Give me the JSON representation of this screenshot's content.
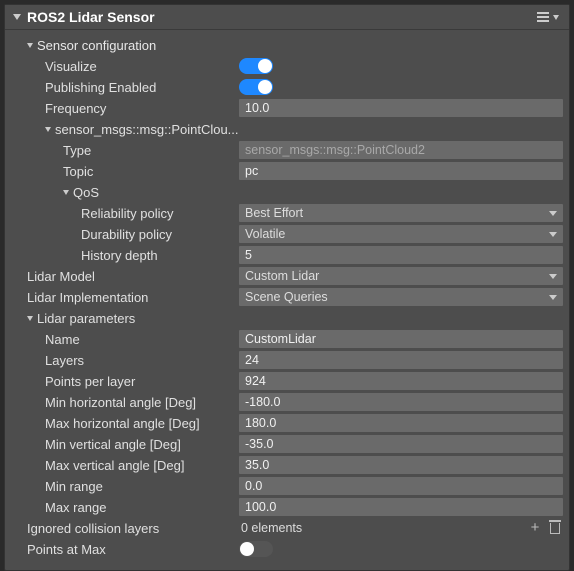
{
  "panel": {
    "title": "ROS2 Lidar Sensor"
  },
  "sensor_config": {
    "label": "Sensor configuration",
    "visualize": {
      "label": "Visualize",
      "on": true
    },
    "publishing": {
      "label": "Publishing Enabled",
      "on": true
    },
    "frequency": {
      "label": "Frequency",
      "value": "10.0"
    },
    "pointcloud_section": {
      "label": "sensor_msgs::msg::PointClou...",
      "type": {
        "label": "Type",
        "value": "sensor_msgs::msg::PointCloud2"
      },
      "topic": {
        "label": "Topic",
        "value": "pc"
      },
      "qos": {
        "label": "QoS",
        "reliability": {
          "label": "Reliability policy",
          "value": "Best Effort"
        },
        "durability": {
          "label": "Durability policy",
          "value": "Volatile"
        },
        "history": {
          "label": "History depth",
          "value": "5"
        }
      }
    }
  },
  "lidar_model": {
    "label": "Lidar Model",
    "value": "Custom Lidar"
  },
  "lidar_impl": {
    "label": "Lidar Implementation",
    "value": "Scene Queries"
  },
  "lidar_params": {
    "label": "Lidar parameters",
    "name": {
      "label": "Name",
      "value": "CustomLidar"
    },
    "layers": {
      "label": "Layers",
      "value": "24"
    },
    "points_per_layer": {
      "label": "Points per layer",
      "value": "924"
    },
    "min_h_angle": {
      "label": "Min horizontal angle [Deg]",
      "value": "-180.0"
    },
    "max_h_angle": {
      "label": "Max horizontal angle [Deg]",
      "value": "180.0"
    },
    "min_v_angle": {
      "label": "Min vertical angle [Deg]",
      "value": "-35.0"
    },
    "max_v_angle": {
      "label": "Max vertical angle [Deg]",
      "value": "35.0"
    },
    "min_range": {
      "label": "Min range",
      "value": "0.0"
    },
    "max_range": {
      "label": "Max range",
      "value": "100.0"
    }
  },
  "ignored_layers": {
    "label": "Ignored collision layers",
    "value": "0 elements"
  },
  "points_at_max": {
    "label": "Points at Max",
    "on": false
  }
}
